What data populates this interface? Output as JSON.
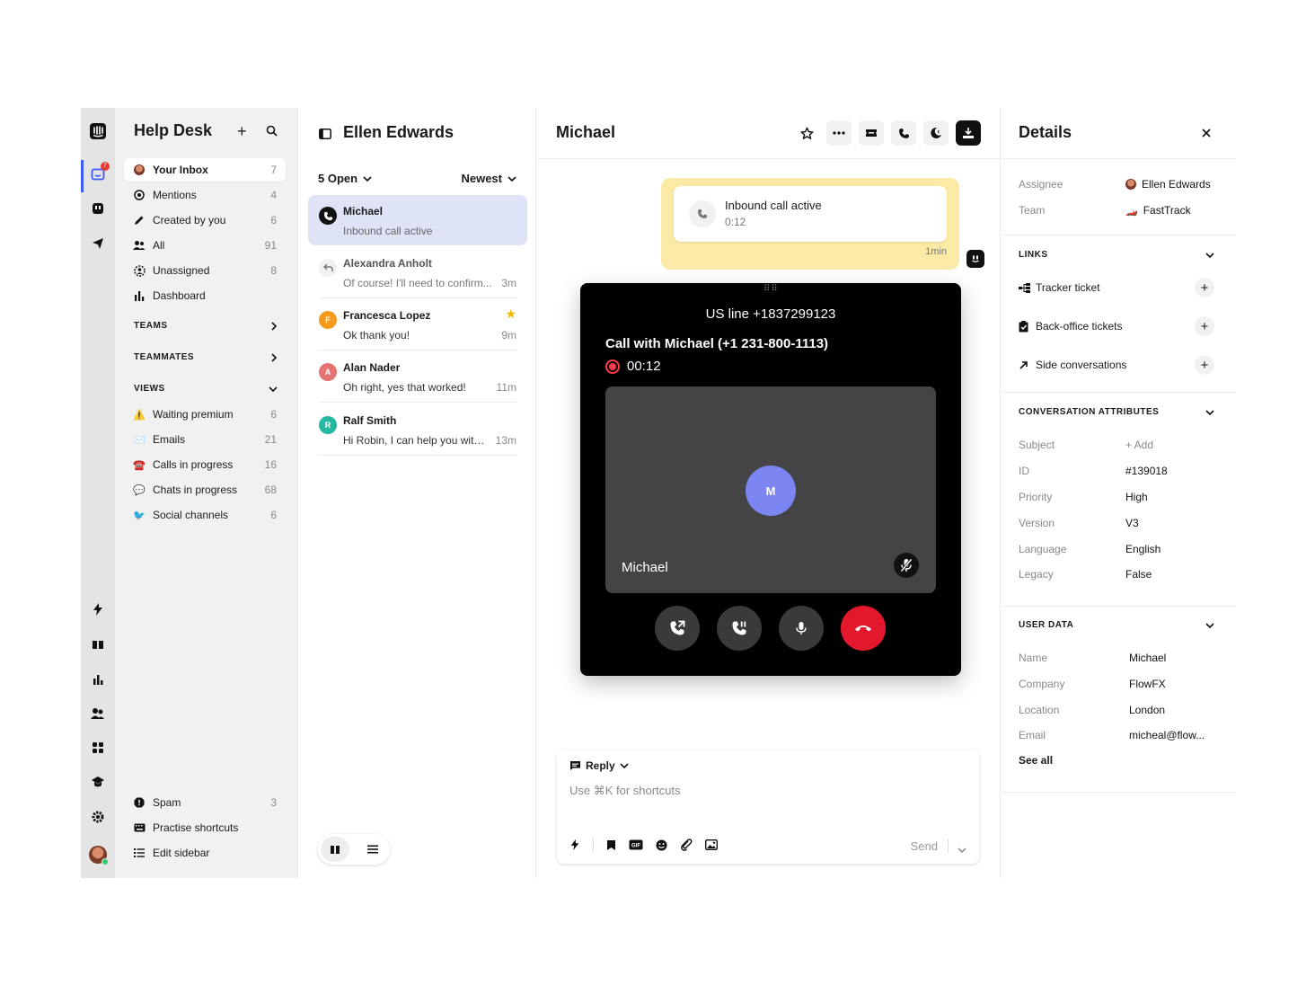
{
  "rail": {
    "inbox_badge": "7"
  },
  "sidebar": {
    "title": "Help Desk",
    "items": [
      {
        "label": "Your Inbox",
        "count": "7"
      },
      {
        "label": "Mentions",
        "count": "4"
      },
      {
        "label": "Created by you",
        "count": "6"
      },
      {
        "label": "All",
        "count": "91"
      },
      {
        "label": "Unassigned",
        "count": "8"
      },
      {
        "label": "Dashboard",
        "count": ""
      }
    ],
    "sections": {
      "teams": "TEAMS",
      "teammates": "TEAMMATES",
      "views": "VIEWS"
    },
    "views": [
      {
        "label": "Waiting premium",
        "count": "6",
        "emoji": "⚠️"
      },
      {
        "label": "Emails",
        "count": "21",
        "emoji": "✉️"
      },
      {
        "label": "Calls in progress",
        "count": "16",
        "emoji": "☎️"
      },
      {
        "label": "Chats in progress",
        "count": "68",
        "emoji": "💬"
      },
      {
        "label": "Social channels",
        "count": "6",
        "emoji": "🐦"
      }
    ],
    "footer": [
      {
        "label": "Spam",
        "count": "3"
      },
      {
        "label": "Practise shortcuts",
        "count": ""
      },
      {
        "label": "Edit sidebar",
        "count": ""
      }
    ]
  },
  "conversations": {
    "title": "Ellen Edwards",
    "filter": "5 Open",
    "sort": "Newest",
    "items": [
      {
        "name": "Michael",
        "preview": "Inbound call active",
        "time": "",
        "initial": "",
        "color": "#111111"
      },
      {
        "name": "Alexandra Anholt",
        "preview": "Of course! I'll need to confirm...",
        "time": "3m",
        "initial": "",
        "color": "#f1f1f1"
      },
      {
        "name": "Francesca Lopez",
        "preview": "Ok thank you!",
        "time": "9m",
        "initial": "F",
        "color": "#f59b1c"
      },
      {
        "name": "Alan Nader",
        "preview": "Oh right, yes that worked!",
        "time": "11m",
        "initial": "A",
        "color": "#e57373"
      },
      {
        "name": "Ralf Smith",
        "preview": "Hi Robin, I can help you with...",
        "time": "13m",
        "initial": "R",
        "color": "#26b8a0"
      }
    ]
  },
  "main": {
    "title": "Michael",
    "call_note": {
      "title": "Inbound call active",
      "duration": "0:12",
      "ago": "1min"
    },
    "phone": {
      "line": "US line +1837299123",
      "with": "Call with Michael (+1 231-800-1113)",
      "timer": "00:12",
      "avatar_initial": "M",
      "caller": "Michael"
    },
    "composer": {
      "mode": "Reply",
      "placeholder": "Use ⌘K for shortcuts",
      "send": "Send"
    }
  },
  "details": {
    "title": "Details",
    "assignee_label": "Assignee",
    "assignee": "Ellen Edwards",
    "team_label": "Team",
    "team": "FastTrack",
    "links_header": "LINKS",
    "links": [
      "Tracker ticket",
      "Back-office tickets",
      "Side conversations"
    ],
    "attributes_header": "CONVERSATION ATTRIBUTES",
    "attributes": [
      {
        "k": "Subject",
        "v": "+ Add"
      },
      {
        "k": "ID",
        "v": "#139018"
      },
      {
        "k": "Priority",
        "v": "High"
      },
      {
        "k": "Version",
        "v": "V3"
      },
      {
        "k": "Language",
        "v": "English"
      },
      {
        "k": "Legacy",
        "v": "False"
      }
    ],
    "user_header": "USER DATA",
    "user": [
      {
        "k": "Name",
        "v": "Michael"
      },
      {
        "k": "Company",
        "v": "FlowFX"
      },
      {
        "k": "Location",
        "v": "London"
      },
      {
        "k": "Email",
        "v": "micheal@flow..."
      }
    ],
    "see_all": "See all"
  },
  "colors": {
    "accent": "#3d5afe",
    "selected_conv": "#dfe3f6",
    "call_note": "#fbe9a6",
    "hangup": "#e3182d",
    "avatar_purple": "#7b86f2"
  }
}
